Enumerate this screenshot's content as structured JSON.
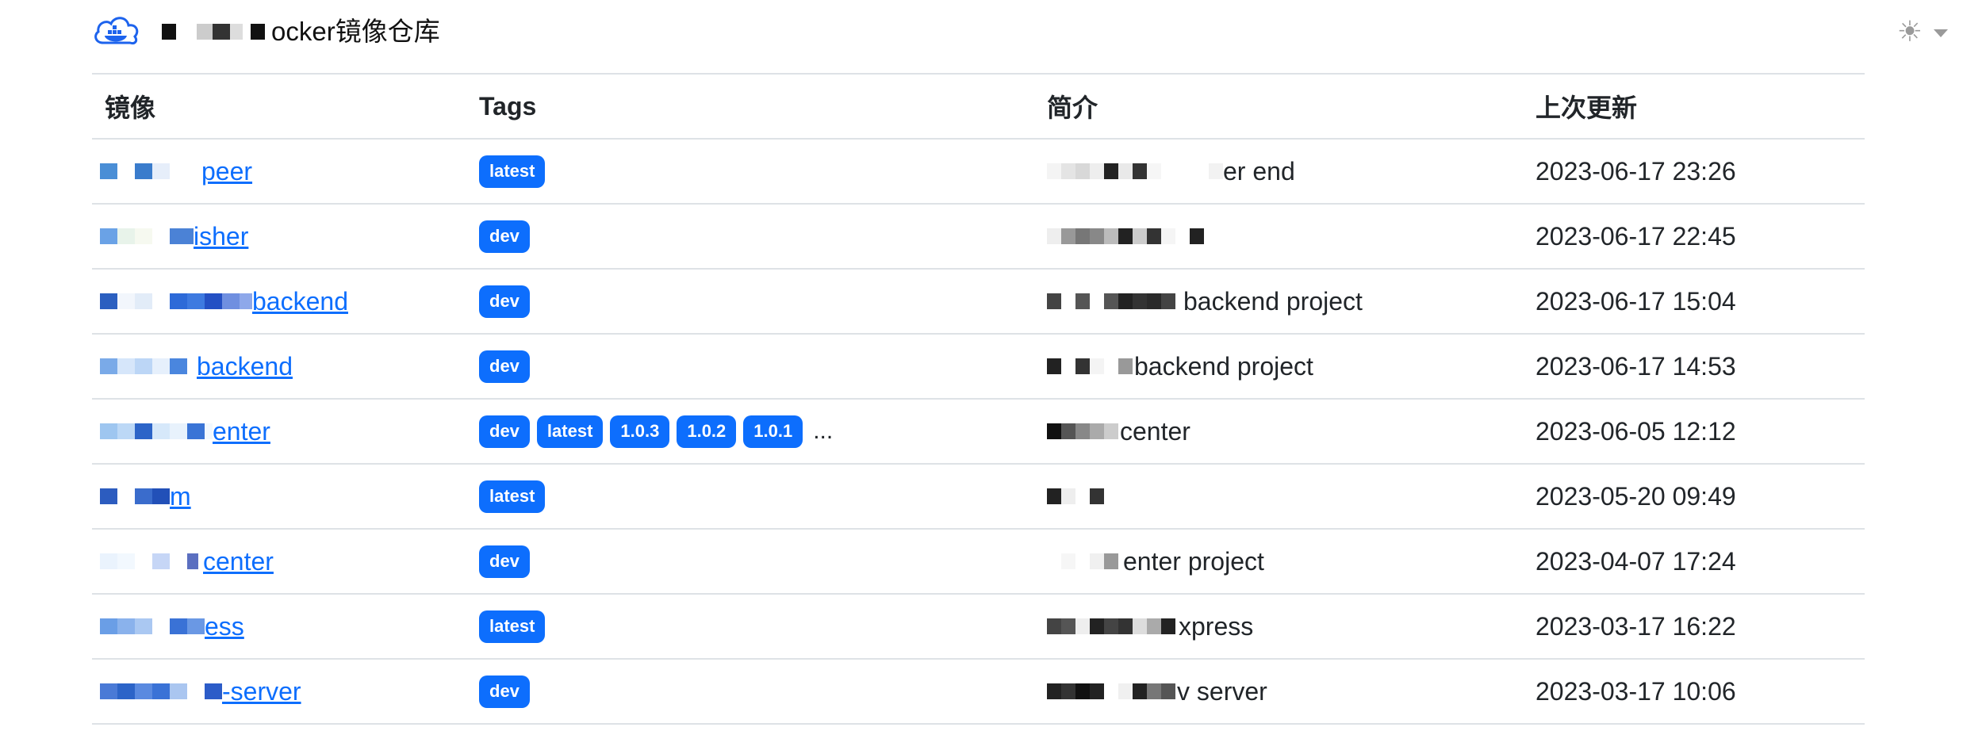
{
  "header": {
    "title": "ocker镜像仓库",
    "logo_icon": "docker-cloud-icon",
    "theme_icon": "sun-icon",
    "theme_caret_icon": "caret-down-icon"
  },
  "columns": [
    "镜像",
    "Tags",
    "简介",
    "上次更新"
  ],
  "rows": [
    {
      "name": "peer",
      "tags": [
        "latest"
      ],
      "desc": "er end",
      "updated": "2023-06-17 23:26"
    },
    {
      "name": "isher",
      "tags": [
        "dev"
      ],
      "desc": "",
      "updated": "2023-06-17 22:45"
    },
    {
      "name": "backend",
      "tags": [
        "dev"
      ],
      "desc": "backend project",
      "updated": "2023-06-17 15:04"
    },
    {
      "name": "backend",
      "tags": [
        "dev"
      ],
      "desc": "backend project",
      "updated": "2023-06-17 14:53"
    },
    {
      "name": "enter",
      "tags": [
        "dev",
        "latest",
        "1.0.3",
        "1.0.2",
        "1.0.1"
      ],
      "more": "...",
      "desc": "center",
      "updated": "2023-06-05 12:12"
    },
    {
      "name": "m",
      "tags": [
        "latest"
      ],
      "desc": "",
      "updated": "2023-05-20 09:49"
    },
    {
      "name": "center",
      "tags": [
        "dev"
      ],
      "desc": "enter project",
      "updated": "2023-04-07 17:24"
    },
    {
      "name": "ess",
      "tags": [
        "latest"
      ],
      "desc": "xpress",
      "updated": "2023-03-17 16:22"
    },
    {
      "name": "-server",
      "tags": [
        "dev"
      ],
      "desc": "v server",
      "updated": "2023-03-17 10:06"
    }
  ],
  "colors": {
    "link": "#0d6efd",
    "badge": "#0d6efd",
    "border": "#dee2e6"
  }
}
